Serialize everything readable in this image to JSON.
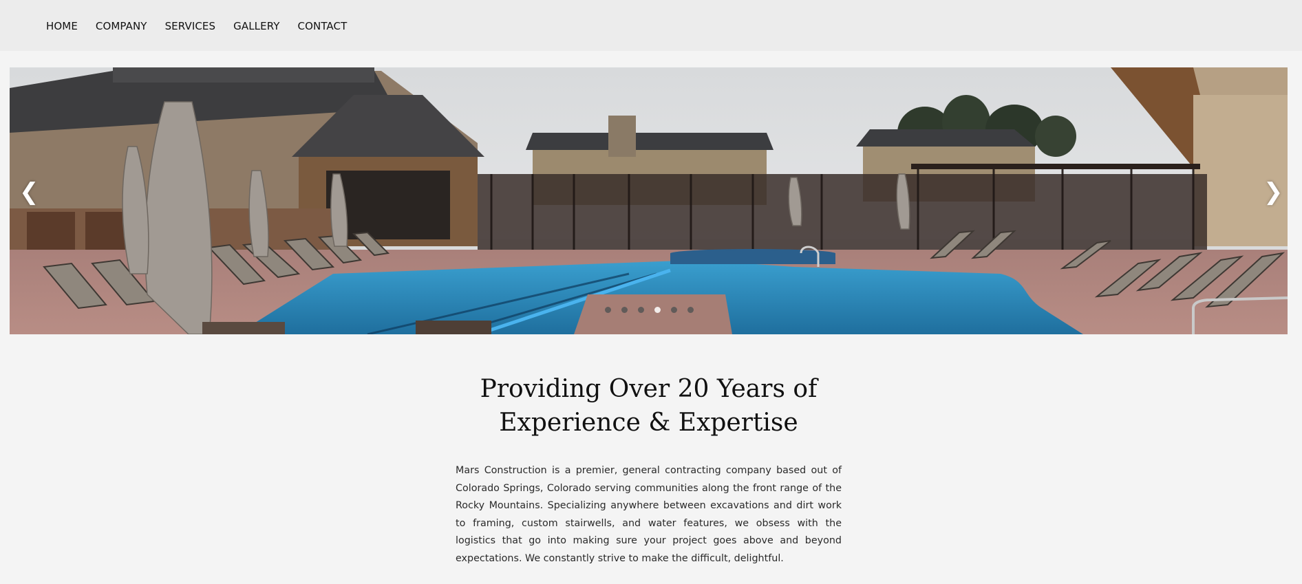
{
  "nav": {
    "items": [
      {
        "label": "HOME"
      },
      {
        "label": "COMPANY"
      },
      {
        "label": "SERVICES"
      },
      {
        "label": "GALLERY"
      },
      {
        "label": "CONTACT"
      }
    ]
  },
  "slider": {
    "prev_label": "❮",
    "next_label": "❯",
    "slide_count": 6,
    "active_index": 3,
    "image_subject": "resort pool with lounge chairs and umbrellas"
  },
  "content": {
    "headline_line1": "Providing Over 20 Years of",
    "headline_line2": "Experience & Expertise",
    "intro": "Mars Construction is a premier, general contracting company based out of Colorado Springs, Colorado serving communities along the front range of the Rocky Mountains. Specializing anywhere between excavations and dirt work to framing, custom stairwells, and water features, we obsess with the logistics that go into making sure your project goes above and beyond expectations. We constantly strive to make the difficult, delightful."
  },
  "colors": {
    "page_bg": "#f4f4f4",
    "nav_bg": "#ececec",
    "pool_water": "#2e86b4",
    "deck": "#b48a80"
  }
}
